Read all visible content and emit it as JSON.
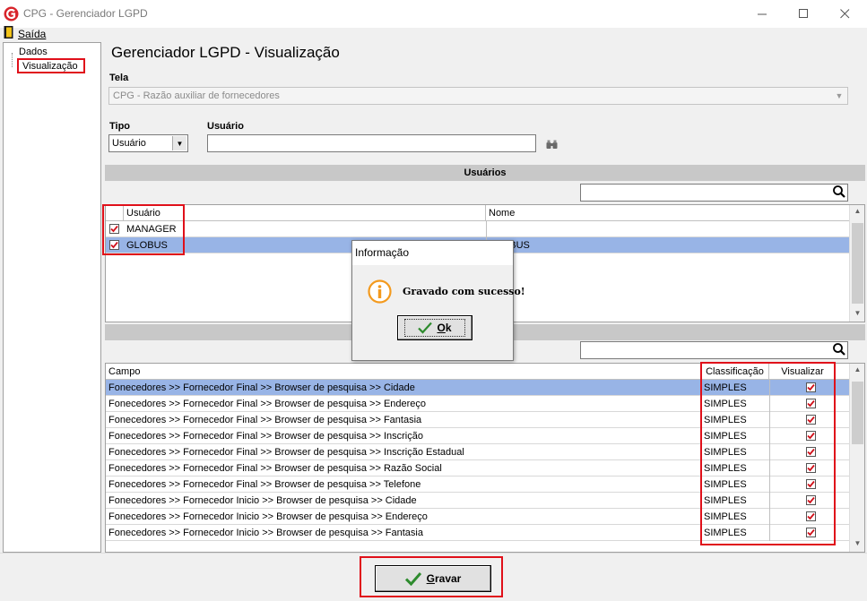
{
  "window": {
    "title": "CPG - Gerenciador LGPD"
  },
  "menu": {
    "saida": "Saída"
  },
  "tree": {
    "items": [
      {
        "label": "Dados"
      },
      {
        "label": "Visualização"
      }
    ]
  },
  "main": {
    "title": "Gerenciador LGPD - Visualização",
    "tela_label": "Tela",
    "tela_value": "CPG - Razão auxiliar de fornecedores",
    "tipo_label": "Tipo",
    "tipo_value": "Usuário",
    "usuario_label": "Usuário",
    "usuario_value": ""
  },
  "usuarios": {
    "section_title": "Usuários",
    "columns": [
      "Usuário",
      "Nome"
    ],
    "rows": [
      {
        "checked": true,
        "usuario": "MANAGER",
        "nome": "",
        "selected": false
      },
      {
        "checked": true,
        "usuario": "GLOBUS",
        "nome": "GLOBUS",
        "selected": true
      }
    ]
  },
  "campos": {
    "section_title": "Campos",
    "columns": [
      "Campo",
      "Classificação",
      "Visualizar"
    ],
    "rows": [
      {
        "campo": "Fonecedores >> Fornecedor  Final >> Browser de pesquisa >> Cidade",
        "classificacao": "SIMPLES",
        "visualizar": true,
        "selected": true
      },
      {
        "campo": "Fonecedores >> Fornecedor  Final >> Browser de pesquisa >> Endereço",
        "classificacao": "SIMPLES",
        "visualizar": true,
        "selected": false
      },
      {
        "campo": "Fonecedores >> Fornecedor  Final >> Browser de pesquisa >> Fantasia",
        "classificacao": "SIMPLES",
        "visualizar": true,
        "selected": false
      },
      {
        "campo": "Fonecedores >> Fornecedor  Final >> Browser de pesquisa >> Inscrição",
        "classificacao": "SIMPLES",
        "visualizar": true,
        "selected": false
      },
      {
        "campo": "Fonecedores >> Fornecedor  Final >> Browser de pesquisa >> Inscrição Estadual",
        "classificacao": "SIMPLES",
        "visualizar": true,
        "selected": false
      },
      {
        "campo": "Fonecedores >> Fornecedor  Final >> Browser de pesquisa >> Razão Social",
        "classificacao": "SIMPLES",
        "visualizar": true,
        "selected": false
      },
      {
        "campo": "Fonecedores >> Fornecedor  Final >> Browser de pesquisa >> Telefone",
        "classificacao": "SIMPLES",
        "visualizar": true,
        "selected": false
      },
      {
        "campo": "Fonecedores >> Fornecedor  Inicio >> Browser de pesquisa >> Cidade",
        "classificacao": "SIMPLES",
        "visualizar": true,
        "selected": false
      },
      {
        "campo": "Fonecedores >> Fornecedor  Inicio >> Browser de pesquisa >> Endereço",
        "classificacao": "SIMPLES",
        "visualizar": true,
        "selected": false
      },
      {
        "campo": "Fonecedores >> Fornecedor  Inicio >> Browser de pesquisa >> Fantasia",
        "classificacao": "SIMPLES",
        "visualizar": true,
        "selected": false
      }
    ]
  },
  "buttons": {
    "gravar_u": "G",
    "gravar_rest": "ravar"
  },
  "dialog": {
    "title": "Informação",
    "message": "Gravado com sucesso!",
    "ok_u": "O",
    "ok_rest": "k"
  },
  "colors": {
    "accent_red": "#e0101a",
    "selection": "#98b4e6",
    "check_red": "#d0101a",
    "ok_green": "#2e8b2e"
  }
}
